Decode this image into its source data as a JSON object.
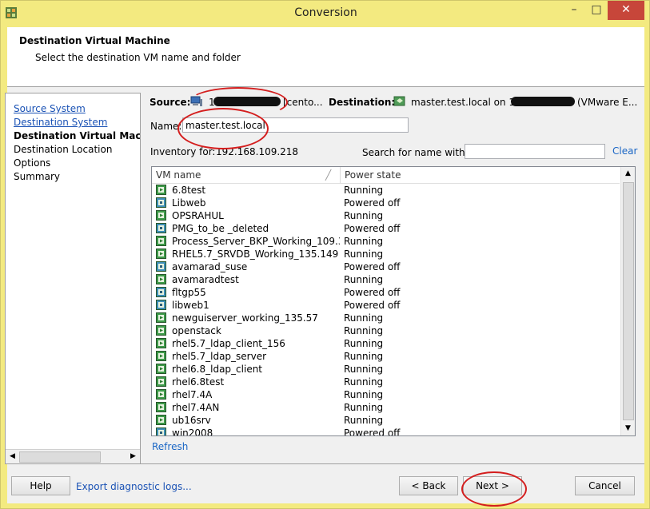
{
  "window": {
    "title": "Conversion",
    "minimize_glyph": "–",
    "maximize_glyph": "□",
    "close_glyph": "✕"
  },
  "header": {
    "title": "Destination Virtual Machine",
    "subtitle": "Select the destination VM name and folder"
  },
  "nav": {
    "items": [
      {
        "label": "Source System",
        "state": "link"
      },
      {
        "label": "Destination System",
        "state": "link"
      },
      {
        "label": "Destination Virtual Machine",
        "state": "current"
      },
      {
        "label": "Destination Location",
        "state": "plain"
      },
      {
        "label": "Options",
        "state": "plain"
      },
      {
        "label": "Summary",
        "state": "plain"
      }
    ]
  },
  "summary": {
    "source_label": "Source:",
    "source_value_prefix": "1",
    "source_value_suffix": "[cento...",
    "destination_label": "Destination:",
    "destination_value": "master.test.local on 192",
    "destination_suffix": "(VMware E..."
  },
  "form": {
    "name_label": "Name:",
    "name_value": "master.test.local",
    "inventory_label": "Inventory for:",
    "inventory_value": "192.168.109.218",
    "search_label": "Search for name with:",
    "search_value": "",
    "clear_label": "Clear",
    "refresh_label": "Refresh"
  },
  "table": {
    "columns": [
      "VM name",
      "Power state"
    ],
    "rows": [
      {
        "name": "6.8test",
        "state": "Running"
      },
      {
        "name": "Libweb",
        "state": "Powered off"
      },
      {
        "name": "OPSRAHUL",
        "state": "Running"
      },
      {
        "name": "PMG_to_be _deleted",
        "state": "Powered off"
      },
      {
        "name": "Process_Server_BKP_Working_109.38",
        "state": "Running"
      },
      {
        "name": "RHEL5.7_SRVDB_Working_135.149",
        "state": "Running"
      },
      {
        "name": "avamarad_suse",
        "state": "Powered off"
      },
      {
        "name": "avamaradtest",
        "state": "Running"
      },
      {
        "name": "fltgp55",
        "state": "Powered off"
      },
      {
        "name": "libweb1",
        "state": "Powered off"
      },
      {
        "name": "newguiserver_working_135.57",
        "state": "Running"
      },
      {
        "name": "openstack",
        "state": "Running"
      },
      {
        "name": "rhel5.7_ldap_client_156",
        "state": "Running"
      },
      {
        "name": "rhel5.7_ldap_server",
        "state": "Running"
      },
      {
        "name": "rhel6.8_ldap_client",
        "state": "Running"
      },
      {
        "name": "rhel6.8test",
        "state": "Running"
      },
      {
        "name": "rhel7.4A",
        "state": "Running"
      },
      {
        "name": "rhel7.4AN",
        "state": "Running"
      },
      {
        "name": "ub16srv",
        "state": "Running"
      },
      {
        "name": "win2008",
        "state": "Powered off"
      }
    ],
    "scroll_up_glyph": "▲",
    "scroll_down_glyph": "▼",
    "sort_glyph": "╱"
  },
  "footer": {
    "help_label": "Help",
    "export_label": "Export diagnostic logs...",
    "back_label": "< Back",
    "next_label": "Next >",
    "cancel_label": "Cancel"
  },
  "icons": {
    "app": "converter-icon",
    "computer": "computer-icon",
    "vm_running": "vm-running-icon",
    "vm_off": "vm-off-icon"
  },
  "colors": {
    "frame": "#f3ea80",
    "close_button": "#c7463a",
    "link": "#1a52b5",
    "annotation": "#d41e1e"
  }
}
